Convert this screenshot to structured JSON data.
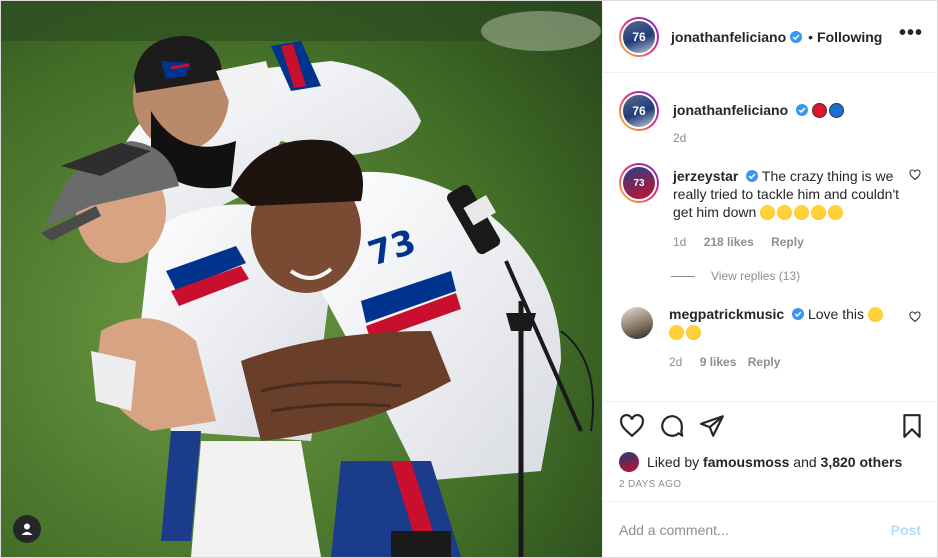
{
  "photo": {
    "alt_icon": "user-tag-icon"
  },
  "header": {
    "username": "jonathanfeliciano",
    "separator": "•",
    "follow_state": "Following",
    "more": "•••",
    "avatar_text": "76"
  },
  "caption": {
    "username": "jonathanfeliciano",
    "emojis": [
      "red-circle",
      "blue-circle"
    ],
    "time": "2d",
    "avatar_text": "76"
  },
  "comments": [
    {
      "username": "jerzeystar",
      "text": "The crazy thing is we really tried to tackle him and couldn't get him down",
      "emoji_count": 5,
      "time": "1d",
      "likes": "218 likes",
      "reply": "Reply",
      "view_replies": "View replies (13)",
      "avatar_text": "73"
    },
    {
      "username": "megpatrickmusic",
      "text": "Love this",
      "emoji_count": 3,
      "time": "2d",
      "likes": "9 likes",
      "reply": "Reply"
    }
  ],
  "likes": {
    "prefix": "Liked by",
    "user": "famousmoss",
    "middle": "and",
    "count": "3,820 others"
  },
  "timestamp": "2 DAYS AGO",
  "composer": {
    "placeholder": "Add a comment...",
    "post_label": "Post"
  },
  "colors": {
    "verified": "#3897f0",
    "post_disabled": "#b2dffc",
    "secondary_text": "#8e8e8e",
    "bills_red": "#c8102e",
    "bills_blue": "#00338d"
  }
}
